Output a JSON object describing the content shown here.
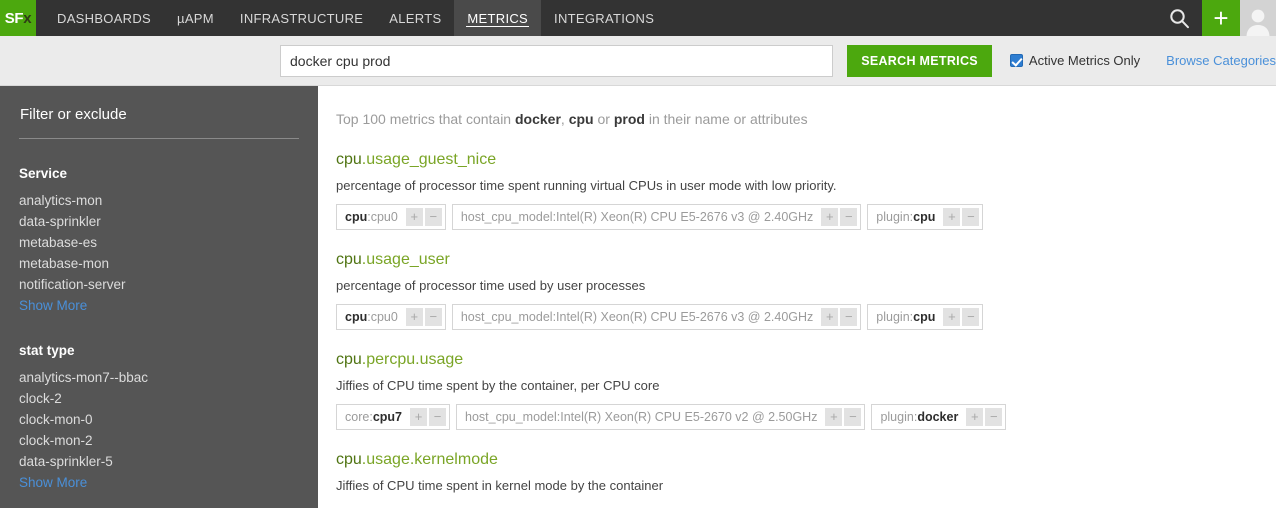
{
  "topnav": {
    "logo": {
      "primary": "SF",
      "accent": "x"
    },
    "links": [
      {
        "label": "DASHBOARDS",
        "active": false
      },
      {
        "label": "µAPM",
        "active": false
      },
      {
        "label": "INFRASTRUCTURE",
        "active": false
      },
      {
        "label": "ALERTS",
        "active": false
      },
      {
        "label": "METRICS",
        "active": true
      },
      {
        "label": "INTEGRATIONS",
        "active": false
      }
    ],
    "search_icon": "search-icon",
    "add_icon": "plus-icon",
    "avatar_icon": "user-avatar-icon"
  },
  "search": {
    "value": "docker cpu prod",
    "placeholder": "Search metrics",
    "button_label": "SEARCH METRICS",
    "active_only_label": "Active Metrics Only",
    "active_only_checked": true,
    "browse_categories_label": "Browse Categories"
  },
  "sidebar": {
    "title": "Filter or exclude",
    "facets": [
      {
        "title": "Service",
        "items": [
          "analytics-mon",
          "data-sprinkler",
          "metabase-es",
          "metabase-mon",
          "notification-server"
        ],
        "show_more_label": "Show More"
      },
      {
        "title": "stat type",
        "items": [
          "analytics-mon7--bbac",
          "clock-2",
          "clock-mon-0",
          "clock-mon-2",
          "data-sprinkler-5"
        ],
        "show_more_label": "Show More"
      }
    ]
  },
  "results": {
    "summary": {
      "prefix": "Top 100 metrics that contain ",
      "term1": "docker",
      "sep1": ", ",
      "term2": "cpu",
      "sep2": " or ",
      "term3": "prod",
      "suffix": " in their name or attributes"
    },
    "items": [
      {
        "name_highlight": "cpu",
        "name_rest": ".usage_guest_nice",
        "description": "percentage of processor time spent running virtual CPUs in user mode with low priority.",
        "chips": [
          {
            "key": "cpu",
            "key_bold": true,
            "sep": ":",
            "value": "cpu0",
            "value_bold": false,
            "add_label": "+",
            "remove_label": "−"
          },
          {
            "key": "host_cpu_model",
            "key_bold": false,
            "sep": ":",
            "value": "Intel(R) Xeon(R) CPU E5-2676 v3 @ 2.40GHz",
            "value_bold": false,
            "add_label": "+",
            "remove_label": "−"
          },
          {
            "key": "plugin",
            "key_bold": false,
            "sep": ":",
            "value": "cpu",
            "value_bold": true,
            "add_label": "+",
            "remove_label": "−"
          }
        ]
      },
      {
        "name_highlight": "cpu",
        "name_rest": ".usage_user",
        "description": "percentage of processor time used by user processes",
        "chips": [
          {
            "key": "cpu",
            "key_bold": true,
            "sep": ":",
            "value": "cpu0",
            "value_bold": false,
            "add_label": "+",
            "remove_label": "−"
          },
          {
            "key": "host_cpu_model",
            "key_bold": false,
            "sep": ":",
            "value": "Intel(R) Xeon(R) CPU E5-2676 v3 @ 2.40GHz",
            "value_bold": false,
            "add_label": "+",
            "remove_label": "−"
          },
          {
            "key": "plugin",
            "key_bold": false,
            "sep": ":",
            "value": "cpu",
            "value_bold": true,
            "add_label": "+",
            "remove_label": "−"
          }
        ]
      },
      {
        "name_highlight": "cpu",
        "name_rest": ".percpu.usage",
        "description": "Jiffies of CPU time spent by the container, per CPU core",
        "chips": [
          {
            "key": "core",
            "key_bold": false,
            "sep": ":",
            "value": "cpu7",
            "value_bold": true,
            "add_label": "+",
            "remove_label": "−"
          },
          {
            "key": "host_cpu_model",
            "key_bold": false,
            "sep": ":",
            "value": "Intel(R) Xeon(R) CPU E5-2670 v2 @ 2.50GHz",
            "value_bold": false,
            "add_label": "+",
            "remove_label": "−"
          },
          {
            "key": "plugin",
            "key_bold": false,
            "sep": ":",
            "value": "docker",
            "value_bold": true,
            "add_label": "+",
            "remove_label": "−"
          }
        ]
      },
      {
        "name_highlight": "cpu",
        "name_rest": ".usage.kernelmode",
        "description": "Jiffies of CPU time spent in kernel mode by the container",
        "chips": []
      }
    ]
  }
}
